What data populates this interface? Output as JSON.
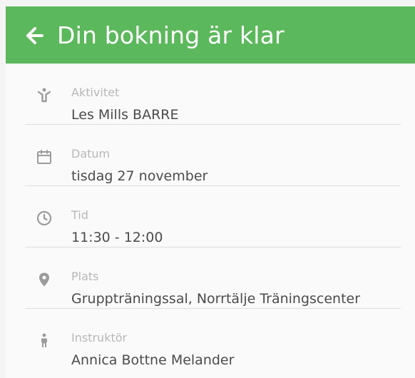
{
  "header": {
    "title": "Din bokning är klar",
    "back_icon": "arrow-left-icon",
    "background": "#5cb85c"
  },
  "details": [
    {
      "label": "Aktivitet",
      "value": "Les Mills BARRE",
      "icon": "activity-icon"
    },
    {
      "label": "Datum",
      "value": "tisdag 27 november",
      "icon": "calendar-icon"
    },
    {
      "label": "Tid",
      "value": "11:30 - 12:00",
      "icon": "clock-icon"
    },
    {
      "label": "Plats",
      "value": "Gruppträningssal, Norrtälje Träningscenter",
      "icon": "location-icon"
    },
    {
      "label": "Instruktör",
      "value": "Annica Bottne Melander",
      "icon": "person-icon"
    }
  ],
  "colors": {
    "label": "#b7b7b7",
    "value": "#4b4b4b",
    "divider": "#dedede",
    "icon": "#9b9b9b"
  }
}
